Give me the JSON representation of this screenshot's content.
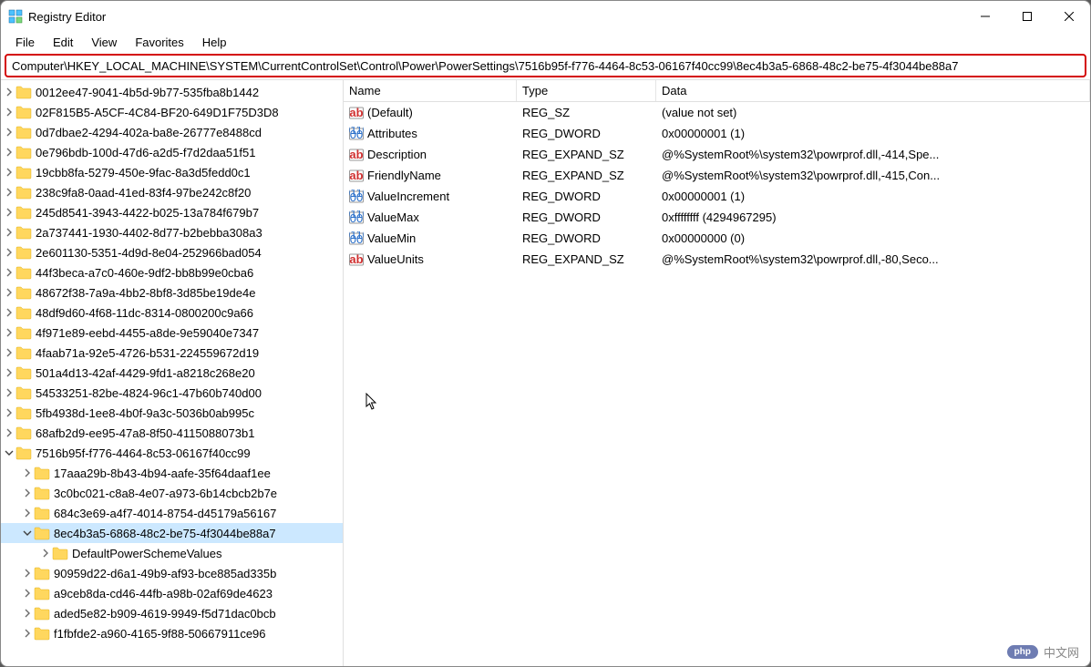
{
  "title": "Registry Editor",
  "menus": [
    "File",
    "Edit",
    "View",
    "Favorites",
    "Help"
  ],
  "address": "Computer\\HKEY_LOCAL_MACHINE\\SYSTEM\\CurrentControlSet\\Control\\Power\\PowerSettings\\7516b95f-f776-4464-8c53-06167f40cc99\\8ec4b3a5-6868-48c2-be75-4f3044be88a7",
  "tree": [
    {
      "depth": 0,
      "exp": "right",
      "label": "0012ee47-9041-4b5d-9b77-535fba8b1442"
    },
    {
      "depth": 0,
      "exp": "right",
      "label": "02F815B5-A5CF-4C84-BF20-649D1F75D3D8"
    },
    {
      "depth": 0,
      "exp": "right",
      "label": "0d7dbae2-4294-402a-ba8e-26777e8488cd"
    },
    {
      "depth": 0,
      "exp": "right",
      "label": "0e796bdb-100d-47d6-a2d5-f7d2daa51f51"
    },
    {
      "depth": 0,
      "exp": "right",
      "label": "19cbb8fa-5279-450e-9fac-8a3d5fedd0c1"
    },
    {
      "depth": 0,
      "exp": "right",
      "label": "238c9fa8-0aad-41ed-83f4-97be242c8f20"
    },
    {
      "depth": 0,
      "exp": "right",
      "label": "245d8541-3943-4422-b025-13a784f679b7"
    },
    {
      "depth": 0,
      "exp": "right",
      "label": "2a737441-1930-4402-8d77-b2bebba308a3"
    },
    {
      "depth": 0,
      "exp": "right",
      "label": "2e601130-5351-4d9d-8e04-252966bad054"
    },
    {
      "depth": 0,
      "exp": "right",
      "label": "44f3beca-a7c0-460e-9df2-bb8b99e0cba6"
    },
    {
      "depth": 0,
      "exp": "right",
      "label": "48672f38-7a9a-4bb2-8bf8-3d85be19de4e"
    },
    {
      "depth": 0,
      "exp": "right",
      "label": "48df9d60-4f68-11dc-8314-0800200c9a66"
    },
    {
      "depth": 0,
      "exp": "right",
      "label": "4f971e89-eebd-4455-a8de-9e59040e7347"
    },
    {
      "depth": 0,
      "exp": "right",
      "label": "4faab71a-92e5-4726-b531-224559672d19"
    },
    {
      "depth": 0,
      "exp": "right",
      "label": "501a4d13-42af-4429-9fd1-a8218c268e20"
    },
    {
      "depth": 0,
      "exp": "right",
      "label": "54533251-82be-4824-96c1-47b60b740d00"
    },
    {
      "depth": 0,
      "exp": "right",
      "label": "5fb4938d-1ee8-4b0f-9a3c-5036b0ab995c"
    },
    {
      "depth": 0,
      "exp": "right",
      "label": "68afb2d9-ee95-47a8-8f50-4115088073b1"
    },
    {
      "depth": 0,
      "exp": "down",
      "label": "7516b95f-f776-4464-8c53-06167f40cc99"
    },
    {
      "depth": 1,
      "exp": "right",
      "label": "17aaa29b-8b43-4b94-aafe-35f64daaf1ee"
    },
    {
      "depth": 1,
      "exp": "right",
      "label": "3c0bc021-c8a8-4e07-a973-6b14cbcb2b7e"
    },
    {
      "depth": 1,
      "exp": "right",
      "label": "684c3e69-a4f7-4014-8754-d45179a56167"
    },
    {
      "depth": 1,
      "exp": "down",
      "label": "8ec4b3a5-6868-48c2-be75-4f3044be88a7",
      "selected": true
    },
    {
      "depth": 2,
      "exp": "right",
      "label": "DefaultPowerSchemeValues"
    },
    {
      "depth": 1,
      "exp": "right",
      "label": "90959d22-d6a1-49b9-af93-bce885ad335b"
    },
    {
      "depth": 1,
      "exp": "right",
      "label": "a9ceb8da-cd46-44fb-a98b-02af69de4623"
    },
    {
      "depth": 1,
      "exp": "right",
      "label": "aded5e82-b909-4619-9949-f5d71dac0bcb"
    },
    {
      "depth": 1,
      "exp": "right",
      "label": "f1fbfde2-a960-4165-9f88-50667911ce96"
    }
  ],
  "columns": {
    "name": "Name",
    "type": "Type",
    "data": "Data"
  },
  "values": [
    {
      "icon": "str",
      "name": "(Default)",
      "type": "REG_SZ",
      "data": "(value not set)"
    },
    {
      "icon": "bin",
      "name": "Attributes",
      "type": "REG_DWORD",
      "data": "0x00000001 (1)"
    },
    {
      "icon": "str",
      "name": "Description",
      "type": "REG_EXPAND_SZ",
      "data": "@%SystemRoot%\\system32\\powrprof.dll,-414,Spe..."
    },
    {
      "icon": "str",
      "name": "FriendlyName",
      "type": "REG_EXPAND_SZ",
      "data": "@%SystemRoot%\\system32\\powrprof.dll,-415,Con..."
    },
    {
      "icon": "bin",
      "name": "ValueIncrement",
      "type": "REG_DWORD",
      "data": "0x00000001 (1)"
    },
    {
      "icon": "bin",
      "name": "ValueMax",
      "type": "REG_DWORD",
      "data": "0xffffffff (4294967295)"
    },
    {
      "icon": "bin",
      "name": "ValueMin",
      "type": "REG_DWORD",
      "data": "0x00000000 (0)"
    },
    {
      "icon": "str",
      "name": "ValueUnits",
      "type": "REG_EXPAND_SZ",
      "data": "@%SystemRoot%\\system32\\powrprof.dll,-80,Seco..."
    }
  ],
  "watermark": "中文网"
}
